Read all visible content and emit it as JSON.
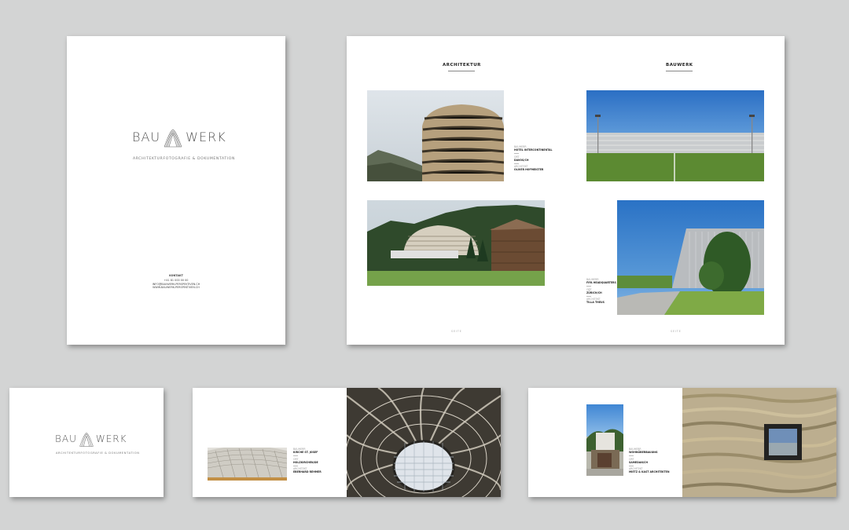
{
  "logo": {
    "left": "BAU",
    "right": "WERK",
    "subtitle": "ARCHITEKTURFOTOGRAFIE & DOKUMENTATION"
  },
  "cover": {
    "contact_heading": "KONTAKT",
    "contact_lines": [
      "+41 81 000 00 00",
      "INFO@BAUWERK-PERSPEKTIVEN.CH",
      "WWW.BAUWERK-PERSPEKTIVEN.CH"
    ]
  },
  "spread": {
    "left_title": "ARCHITEKTUR",
    "right_title": "BAUWERK",
    "left_page_number": "SEITE",
    "right_page_number": "SEITE",
    "caption1": {
      "l1": "BAUHERR",
      "v1": "HOTEL INTERCONTINENTAL",
      "l2": "ORT",
      "v2": "DAVOS/CH",
      "l3": "ARCHITEKT",
      "v3": "OLIVER HOFMEISTER"
    },
    "caption2": {
      "l1": "BAUHERR",
      "v1": "FIFA HEADQUARTERS",
      "l2": "ORT",
      "v2": "ZÜRICH/CH",
      "l3": "ARCHITEKT",
      "v3": "TILLA THEUS"
    }
  },
  "card2": {
    "caption": {
      "l1": "BAUHERR",
      "v1": "KIRCHE ST. JOSEF",
      "l2": "ORT",
      "v2": "HOLZKIRCHEN/DE",
      "l3": "ARCHITEKT",
      "v3": "EBERHARD REHMER"
    }
  },
  "card3": {
    "caption": {
      "l1": "BAUHERR",
      "v1": "WOHNÜBERBAUUNG",
      "l2": "ORT",
      "v2": "SAMEDAN/CH",
      "l3": "ARCHITEKT",
      "v3": "MIETZ & KAST ARCHITEKTEN"
    }
  }
}
